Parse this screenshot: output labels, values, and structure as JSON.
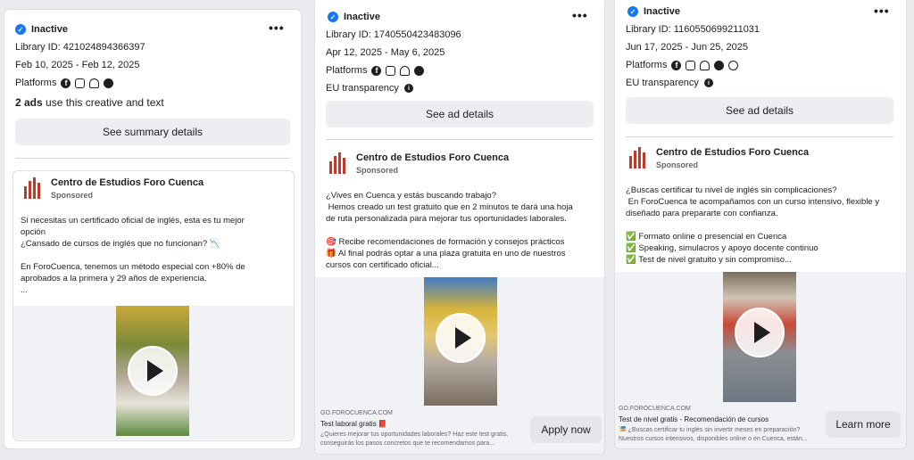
{
  "cards": [
    {
      "status": "Inactive",
      "library_id": "Library ID: 421024894366397",
      "dates": "Feb 10, 2025 - Feb 12, 2025",
      "platforms_label": "Platforms",
      "ads_count": "2 ads",
      "ads_text": " use this creative and text",
      "button": "See summary details",
      "advertiser": "Centro de Estudios Foro Cuenca",
      "sponsored": "Sponsored",
      "body": "Si necesitas un certificado oficial de inglés, esta es tu mejor\nopción\n¿Cansado de cursos de inglés que no funcionan? 📉\n\nEn ForoCuenca, tenemos un método especial con +80% de\naprobados a la primera y 29 años de experiencia.\n..."
    },
    {
      "status": "Inactive",
      "library_id": "Library ID: 1740550423483096",
      "dates": "Apr 12, 2025 - May 6, 2025",
      "platforms_label": "Platforms",
      "eu_transparency": "EU transparency",
      "button": "See ad details",
      "advertiser": "Centro de Estudios Foro Cuenca",
      "sponsored": "Sponsored",
      "body": "¿Vives en Cuenca y estás buscando trabajo?\n Hemos creado un test gratuito que en 2 minutos te dará una hoja\nde ruta personalizada para mejorar tus oportunidades laborales.\n\n🎯 Recibe recomendaciones de formación y consejos prácticos\n🎁 Al final podrás optar a una plaza gratuita en uno de nuestros\ncursos con certificado oficial...",
      "cta_url": "GO.FOROCUENCA.COM",
      "cta_title": "Test laboral gratis 📕",
      "cta_desc": "¿Quieres mejorar tus oportunidades laborales? Haz este test gratis,\nconseguirás los pasos concretos que te recomendamos para...",
      "cta_button": "Apply now"
    },
    {
      "status": "Inactive",
      "library_id": "Library ID: 1160550699211031",
      "dates": "Jun 17, 2025 - Jun 25, 2025",
      "platforms_label": "Platforms",
      "eu_transparency": "EU transparency",
      "button": "See ad details",
      "advertiser": "Centro de Estudios Foro Cuenca",
      "sponsored": "Sponsored",
      "body": "¿Buscas certificar tu nivel de inglés sin complicaciones?\n En ForoCuenca te acompañamos con un curso intensivo, flexible y\ndiseñado para prepararte con confianza.\n\n✅ Formato online o presencial en Cuenca\n✅ Speaking, simulacros y apoyo docente continuo\n✅ Test de nivel gratuito y sin compromiso...",
      "cta_url": "GO.FOROCUENCA.COM",
      "cta_title": "Test de nivel gratis - Recomendación de cursos",
      "cta_desc": "🎏 ¿Buscas certificar tu inglés sin invertir meses en preparación?\nNuestros cursos intensivos, disponibles online o en Cuenca, están...",
      "cta_button": "Learn more"
    }
  ],
  "icons": {
    "status": "check-badge-icon",
    "more": "more-options-icon",
    "platforms": [
      "facebook-icon",
      "instagram-icon",
      "audience-network-icon",
      "messenger-icon",
      "threads-icon"
    ],
    "info": "info-icon",
    "play": "play-icon"
  },
  "colors": {
    "accent": "#1877f2",
    "brand_logo": "#c0392b"
  }
}
